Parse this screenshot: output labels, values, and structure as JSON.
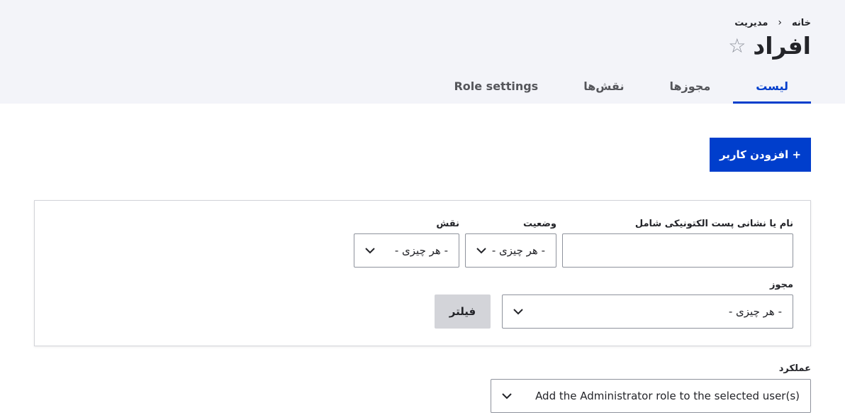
{
  "breadcrumb": {
    "home": "خانه",
    "separator": "‹",
    "admin": "مدیریت"
  },
  "page": {
    "title": "افراد",
    "favorite_glyph": "☆"
  },
  "tabs": [
    {
      "label": "لیست",
      "active": true
    },
    {
      "label": "مجوزها",
      "active": false
    },
    {
      "label": "نقش‌ها",
      "active": false
    },
    {
      "label": "Role settings",
      "active": false
    }
  ],
  "actions": {
    "add_user": "+ افزودن کاربر"
  },
  "filters": {
    "name_label": "نام یا نشانی پست الکتونیکی شامل",
    "name_value": "",
    "status_label": "وضعیت",
    "status_value": "- هر چیزی -",
    "role_label": "نقش",
    "role_value": "- هر چیزی -",
    "permission_label": "مجوز",
    "permission_value": "- هر چیزی -",
    "submit": "فیلتر"
  },
  "bulk": {
    "label": "عملکرد",
    "value": "Add the Administrator role to the selected user(s)"
  },
  "colors": {
    "accent": "#003ecc",
    "header_bg": "#f3f4f9",
    "filter_button_bg": "#d3d4d9"
  }
}
